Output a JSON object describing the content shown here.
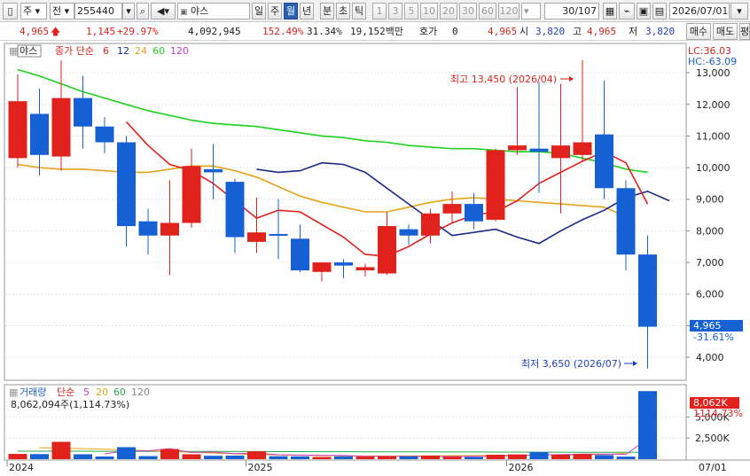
{
  "toolbar": {
    "market_label": "주",
    "type_label": "전",
    "code": "255440",
    "name": "야스",
    "periods": [
      "일",
      "주",
      "월",
      "년",
      "분",
      "초",
      "틱"
    ],
    "selected_period": "월",
    "minutes": [
      "1",
      "3",
      "5",
      "10",
      "20",
      "30",
      "60",
      "120"
    ],
    "count": "30/107",
    "date": "2026/07/01"
  },
  "info": {
    "price": "4,965",
    "change": "1,145",
    "change_pct": "+29.97%",
    "volume": "4,092,945",
    "vol_ratio": "152.49%",
    "turnover_pct": "31.34%",
    "amount": "19,152백만",
    "quote_label": "호가",
    "quote_value": "0",
    "quote_price": "4,965",
    "open_label": "시",
    "open": "3,820",
    "high_label": "고",
    "high": "4,965",
    "low_label": "저",
    "low": "3,820",
    "buy_label": "매수",
    "sell_label": "매도",
    "eval_label": "평"
  },
  "legend": {
    "name": "야스",
    "ma_label": "종가 단순",
    "ma_periods": [
      "6",
      "12",
      "24",
      "60",
      "120"
    ],
    "lc": "LC:36.03",
    "hc": "HC:-63.09"
  },
  "volume_legend": {
    "label": "거래량",
    "ma_label": "단순",
    "ma_periods": [
      "5",
      "20",
      "60",
      "120"
    ],
    "value_text": "8,062,094주(1,114.73%)"
  },
  "annotations": {
    "high": "최고 13,450 (2026/04)",
    "low": "최저 3,650 (2026/07)"
  },
  "price_tag": {
    "value": "4,965",
    "pct": "-31.61%"
  },
  "volume_tag": {
    "value": "8,062K",
    "pct": "1114.73%"
  },
  "colors": {
    "up": "#e1211b",
    "down": "#1560d2",
    "ma6": "#e1211b",
    "ma12": "#1b2a88",
    "ma24": "#e8a31a",
    "ma60": "#1fd11f",
    "ma120": "#c83cc8"
  },
  "chart_data": {
    "type": "candlestick",
    "price_ylim": [
      3300,
      13900
    ],
    "price_ticks": [
      4000,
      5000,
      6000,
      7000,
      8000,
      9000,
      10000,
      11000,
      12000,
      13000
    ],
    "price_tick_labels": [
      "4,000",
      "5,000",
      "6,000",
      "7,000",
      "8,000",
      "9,000",
      "10,000",
      "11,000",
      "12,000",
      "13,000"
    ],
    "x_labels": [
      {
        "index": 0,
        "label": "2024"
      },
      {
        "index": 11,
        "label": "2025"
      },
      {
        "index": 23,
        "label": "2026"
      },
      {
        "index": 32,
        "label": "07/01"
      }
    ],
    "candles": [
      {
        "o": 10300,
        "h": 12950,
        "l": 10000,
        "c": 12100
      },
      {
        "o": 11700,
        "h": 12500,
        "l": 9750,
        "c": 10400
      },
      {
        "o": 10350,
        "h": 13400,
        "l": 9900,
        "c": 12200
      },
      {
        "o": 12200,
        "h": 12900,
        "l": 10600,
        "c": 11300
      },
      {
        "o": 11300,
        "h": 11600,
        "l": 10450,
        "c": 10800
      },
      {
        "o": 10800,
        "h": 11000,
        "l": 7500,
        "c": 8150
      },
      {
        "o": 8300,
        "h": 8700,
        "l": 7250,
        "c": 7850
      },
      {
        "o": 7850,
        "h": 9600,
        "l": 6600,
        "c": 8250
      },
      {
        "o": 8250,
        "h": 10600,
        "l": 8100,
        "c": 10050
      },
      {
        "o": 9950,
        "h": 10750,
        "l": 9000,
        "c": 9850
      },
      {
        "o": 9550,
        "h": 9650,
        "l": 7300,
        "c": 7800
      },
      {
        "o": 7650,
        "h": 9050,
        "l": 7300,
        "c": 7950
      },
      {
        "o": 7900,
        "h": 9000,
        "l": 7100,
        "c": 7850
      },
      {
        "o": 7750,
        "h": 8200,
        "l": 6700,
        "c": 6750
      },
      {
        "o": 6700,
        "h": 7000,
        "l": 6400,
        "c": 7000
      },
      {
        "o": 7000,
        "h": 7100,
        "l": 6500,
        "c": 6900
      },
      {
        "o": 6750,
        "h": 6950,
        "l": 6550,
        "c": 6850
      },
      {
        "o": 6650,
        "h": 8600,
        "l": 6600,
        "c": 8150
      },
      {
        "o": 8050,
        "h": 8200,
        "l": 7550,
        "c": 7850
      },
      {
        "o": 7850,
        "h": 8700,
        "l": 7600,
        "c": 8550
      },
      {
        "o": 8550,
        "h": 9250,
        "l": 8250,
        "c": 8850
      },
      {
        "o": 8850,
        "h": 9200,
        "l": 8050,
        "c": 8300
      },
      {
        "o": 8350,
        "h": 10600,
        "l": 8300,
        "c": 10550
      },
      {
        "o": 10550,
        "h": 12550,
        "l": 10400,
        "c": 10700
      },
      {
        "o": 10600,
        "h": 12700,
        "l": 9200,
        "c": 10500
      },
      {
        "o": 10300,
        "h": 12650,
        "l": 8550,
        "c": 10700
      },
      {
        "o": 10400,
        "h": 13400,
        "l": 10200,
        "c": 10800
      },
      {
        "o": 11050,
        "h": 12750,
        "l": 9000,
        "c": 9350
      },
      {
        "o": 9350,
        "h": 9600,
        "l": 6750,
        "c": 7250
      },
      {
        "o": 7250,
        "h": 7850,
        "l": 3650,
        "c": 4965
      }
    ],
    "ma6": [
      null,
      null,
      null,
      null,
      null,
      11450,
      10700,
      10100,
      9900,
      9500,
      8950,
      8400,
      8650,
      8600,
      8200,
      7800,
      7250,
      7200,
      7500,
      7900,
      8250,
      8500,
      8600,
      8950,
      9500,
      9850,
      10200,
      10500,
      10150,
      8850
    ],
    "ma12": [
      null,
      null,
      null,
      null,
      null,
      null,
      null,
      null,
      null,
      null,
      null,
      9950,
      9850,
      9900,
      10150,
      10100,
      9850,
      9350,
      8850,
      8350,
      7850,
      7950,
      8050,
      7800,
      7600,
      8000,
      8350,
      8650,
      9050,
      9250,
      8950
    ],
    "ma24": [
      10100,
      10000,
      9950,
      9950,
      9900,
      9850,
      9850,
      9950,
      10050,
      10050,
      9900,
      9700,
      9400,
      9100,
      8900,
      8750,
      8600,
      8600,
      8750,
      8900,
      9000,
      9050,
      9000,
      8950,
      8900,
      8850,
      8800,
      8750,
      8450
    ],
    "ma60": [
      13100,
      12900,
      12650,
      12400,
      12200,
      12000,
      11800,
      11650,
      11500,
      11400,
      11350,
      11300,
      11200,
      11100,
      11000,
      10950,
      10850,
      10800,
      10700,
      10650,
      10600,
      10600,
      10550,
      10500,
      10500,
      10450,
      10300,
      10150,
      9950,
      9850
    ],
    "volume": [
      0.62,
      0.6,
      2.05,
      0.58,
      0.32,
      1.42,
      0.36,
      1.2,
      0.58,
      0.4,
      0.42,
      0.92,
      0.35,
      0.33,
      0.26,
      0.33,
      0.3,
      0.32,
      0.34,
      0.42,
      0.28,
      0.25,
      0.52,
      0.56,
      0.84,
      0.54,
      0.6,
      0.48,
      0.3,
      8.06
    ],
    "volume_unit": "M",
    "volume_ylim": [
      0,
      8.4
    ],
    "volume_ticks": [
      2.5,
      5.0
    ],
    "volume_tick_labels": [
      "2,500K",
      "5,000K"
    ],
    "vol_ma5": [
      null,
      null,
      null,
      null,
      0.63,
      1.0,
      0.99,
      1.25,
      0.79,
      0.84,
      0.65,
      0.72,
      0.53,
      0.48,
      0.46,
      0.44,
      0.33,
      0.34,
      0.31,
      0.32,
      0.31,
      0.32,
      0.36,
      0.42,
      0.49,
      0.54,
      0.61,
      0.6,
      0.57,
      2.37
    ],
    "vol_ma20": [
      null,
      1.35,
      1.3,
      1.25,
      1.18,
      1.1,
      1.0,
      0.92,
      0.82,
      0.72,
      0.62,
      0.55,
      0.5,
      0.46,
      0.42,
      0.4,
      0.38,
      0.37,
      0.38,
      0.4,
      0.42,
      0.43,
      0.44,
      0.46,
      0.48,
      0.52,
      0.54,
      0.56,
      0.7
    ],
    "vol_ma60": [
      0.95,
      0.95,
      0.94,
      0.94,
      0.93,
      0.93,
      0.92,
      0.92,
      0.91,
      0.91,
      0.9,
      0.9,
      0.89,
      0.89,
      0.88,
      0.88,
      0.87,
      0.87,
      0.86,
      0.86,
      0.85,
      0.85,
      0.84,
      0.84,
      0.83,
      0.83,
      0.82,
      0.82,
      0.81,
      0.81
    ]
  }
}
